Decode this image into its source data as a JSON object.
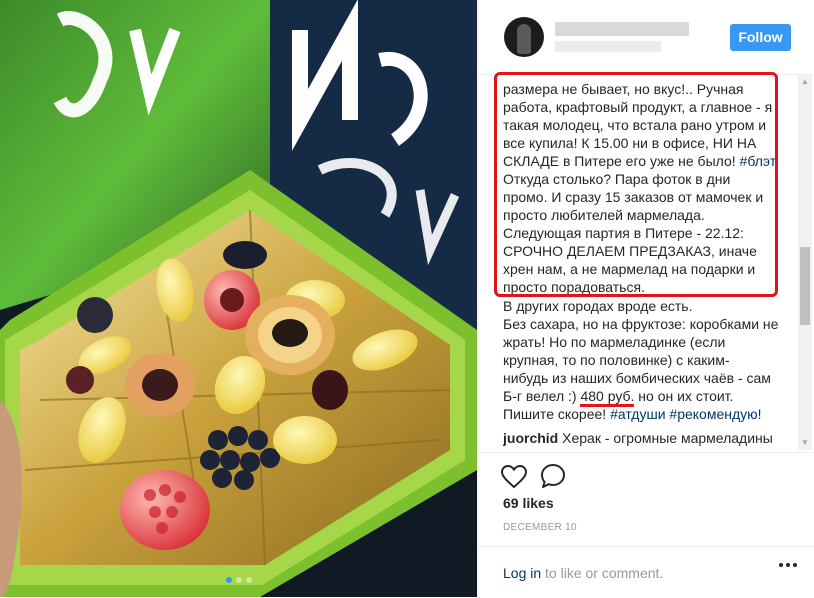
{
  "post": {
    "caption_lines": [
      "размера не бывает, но вкус!.. Ручная",
      "работа, крафтовый продукт, а главное - я",
      "такая молодец, что встала рано утром и",
      "все купила! К 15.00 ни в офисе, НИ НА",
      "СКЛАДЕ в Питере его уже не было!",
      "Откуда столько? Пара фоток в дни",
      "промо. И сразу 15 заказов от мамочек и",
      "просто любителей мармелада.",
      "Следующая партия в Питере - 22.12:",
      "СРОЧНО ДЕЛАЕМ ПРЕДЗАКАЗ, иначе",
      "хрен нам, а не мармелад на подарки и",
      "просто порадоваться.",
      "В других городах вроде есть.",
      "Без сахара, но на фруктозе: коробками не",
      "жрать! Но по мармеладинке (если",
      "крупная, то по половинке) с каким-",
      "нибудь из наших бомбических чаёв - сам",
      "но он их стоит.",
      "Пишите скорее!"
    ],
    "tag_blat": "#блэт",
    "bg_prefix": "Б-г велел :)",
    "price": "480 руб.",
    "tag_atdushi": "#атдуши",
    "tag_recommend": "#рекомендую!"
  },
  "comment": {
    "username": "juorchid",
    "text": "Херак - огромные мармеладины"
  },
  "header": {
    "follow_label": "Follow"
  },
  "likes": "69 likes",
  "date": "DECEMBER 10",
  "footer": {
    "login_label": "Log in",
    "rest_text": " to like or comment."
  },
  "colors": {
    "accent_blue": "#3897f0",
    "hashtag": "#003569",
    "annotation_red": "#e0141c",
    "box_green": "#7cc02e"
  },
  "icons": [
    "heart-icon",
    "comment-icon",
    "more-icon"
  ]
}
